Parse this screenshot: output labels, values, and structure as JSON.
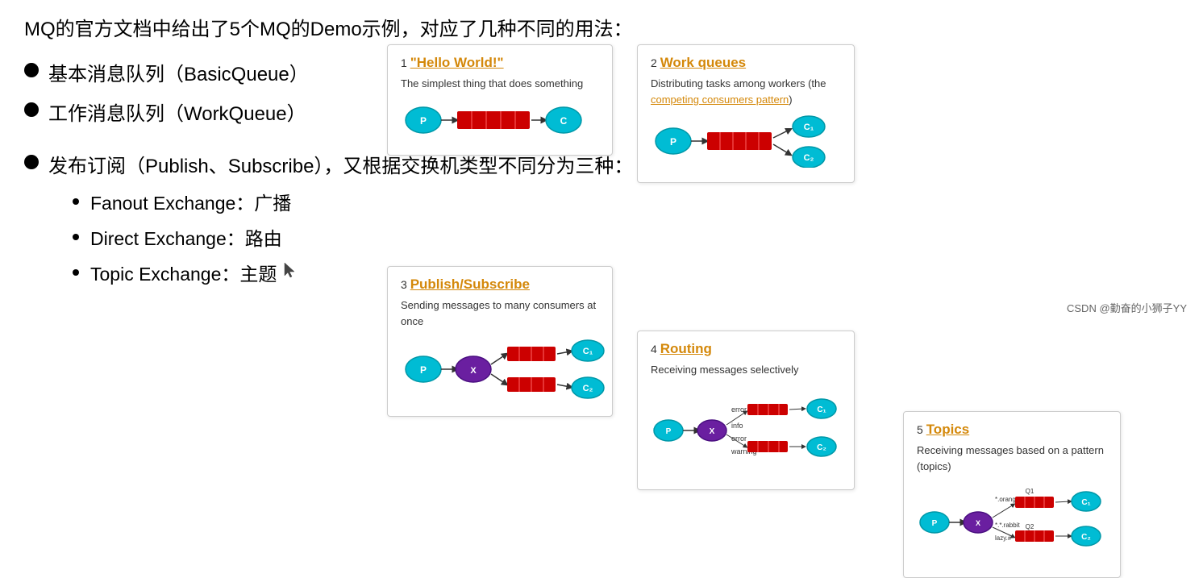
{
  "title": "MQ的官方文档中给出了5个MQ的Demo示例，对应了几种不同的用法：",
  "bullets": [
    {
      "id": "b1",
      "text": "基本消息队列（BasicQueue）"
    },
    {
      "id": "b2",
      "text": "工作消息队列（WorkQueue）"
    },
    {
      "id": "b3",
      "text": "发布订阅（Publish、Subscribe），又根据交换机类型不同分为三种："
    }
  ],
  "sub_bullets": [
    {
      "id": "s1",
      "text": "Fanout Exchange：广播"
    },
    {
      "id": "s2",
      "text": "Direct Exchange：路由"
    },
    {
      "id": "s3",
      "text": "Topic Exchange：主题"
    }
  ],
  "cards": [
    {
      "id": "card1",
      "number": "1",
      "title": "\"Hello World!\"",
      "desc": "The simplest thing that does something"
    },
    {
      "id": "card2",
      "number": "2",
      "title": "Work queues",
      "desc": "Distributing tasks among workers (the competing consumers pattern)"
    },
    {
      "id": "card3",
      "number": "3",
      "title": "Publish/Subscribe",
      "desc": "Sending messages to many consumers at once"
    },
    {
      "id": "card4",
      "number": "4",
      "title": "Routing",
      "desc": "Receiving messages selectively"
    },
    {
      "id": "card5",
      "number": "5",
      "title": "Topics",
      "desc": "Receiving messages based on a pattern (topics)"
    }
  ],
  "watermark": "CSDN @勤奋的小狮子YY",
  "colors": {
    "link": "#d4880a",
    "queue_red": "#cc0000",
    "node_cyan": "#00bcd4",
    "node_purple": "#6a1fa0",
    "arrow": "#333"
  }
}
